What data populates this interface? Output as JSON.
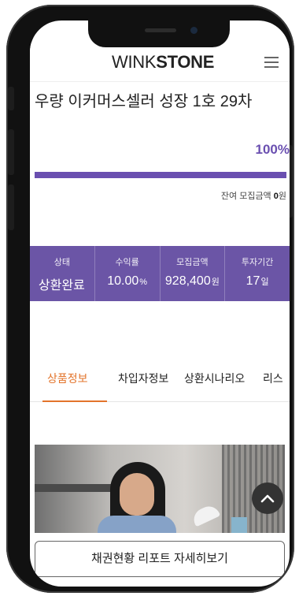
{
  "header": {
    "logo_regular": "WINK",
    "logo_bold": "STONE",
    "menu_icon": "hamburger-icon"
  },
  "product": {
    "title": "우량 이커머스셀러 성장 1호 29차",
    "progress_label": "100%",
    "progress_fraction": 1.0,
    "remaining_label": "잔여 모집금액 ",
    "remaining_amount": "0",
    "remaining_unit": "원"
  },
  "stats": [
    {
      "label": "상태",
      "value": "상환완료",
      "unit": ""
    },
    {
      "label": "수익률",
      "value": "10.00",
      "unit": "%"
    },
    {
      "label": "모집금액",
      "value": "928,400",
      "unit": "원"
    },
    {
      "label": "투자기간",
      "value": "17",
      "unit": "일"
    }
  ],
  "tabs": [
    {
      "label": "상품정보",
      "active": true
    },
    {
      "label": "차입자정보",
      "active": false
    },
    {
      "label": "상환시나리오",
      "active": false
    },
    {
      "label": "리스",
      "active": false
    }
  ],
  "scroll_top_icon": "chevron-up-icon",
  "report_button_label": "채권현황 리포트 자세히보기",
  "colors": {
    "accent_purple": "#6b55a6",
    "tab_orange": "#e3742b"
  }
}
